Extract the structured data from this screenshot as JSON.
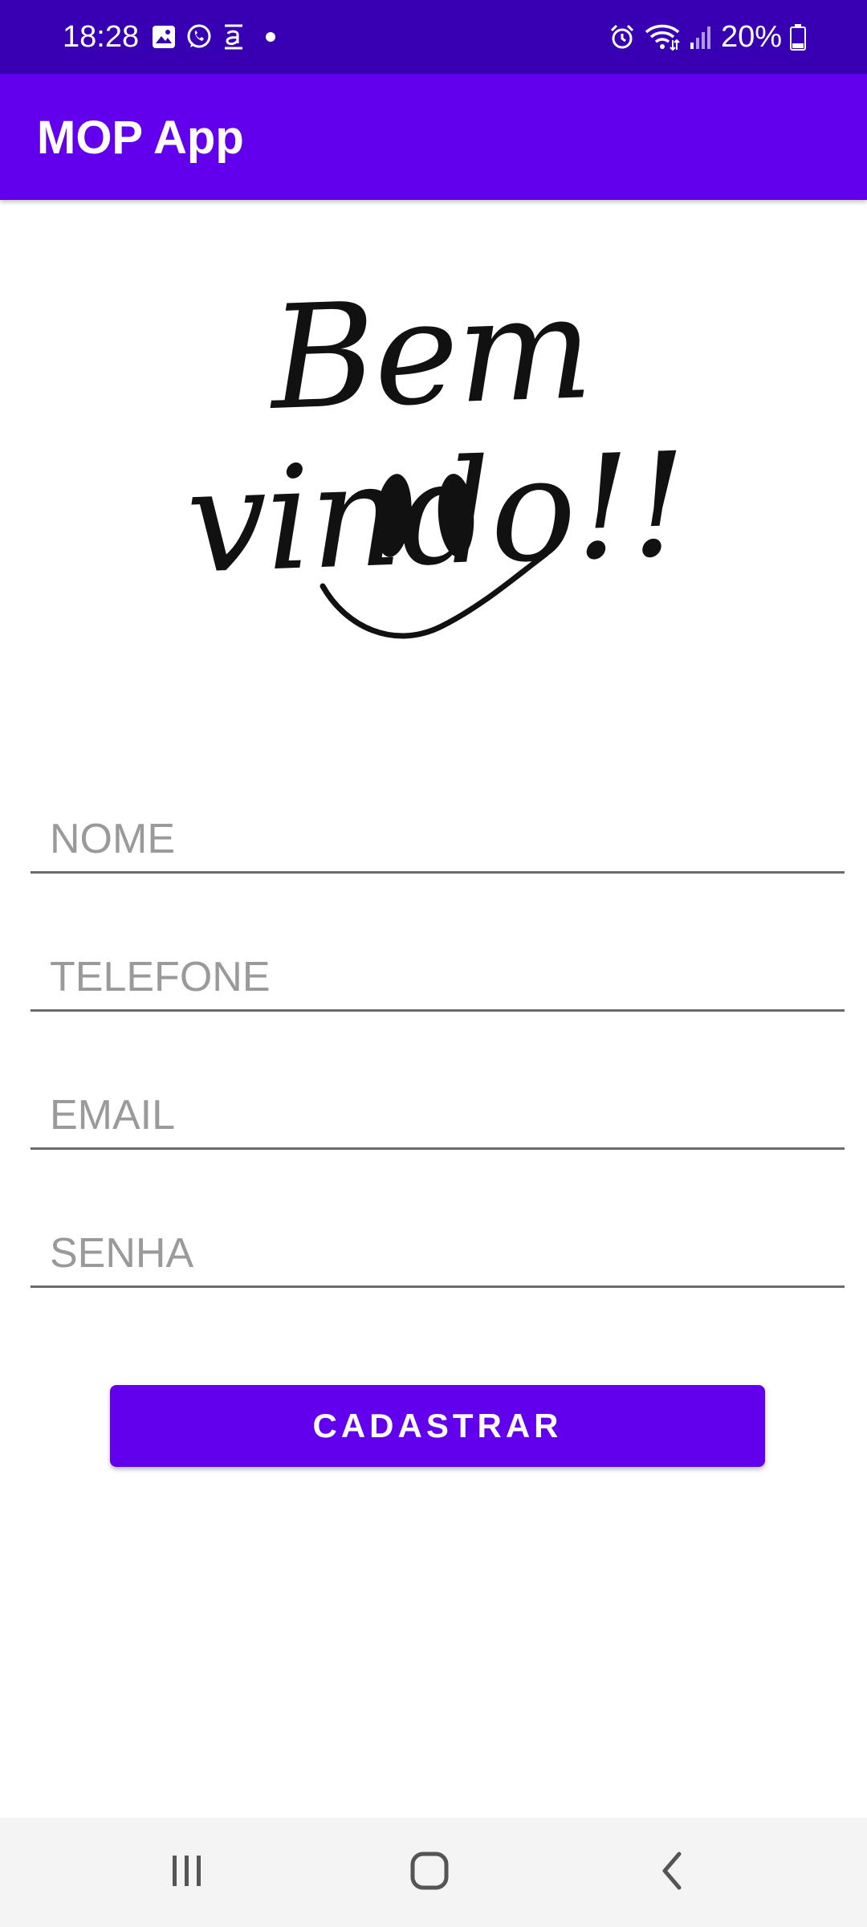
{
  "status_bar": {
    "time": "18:28",
    "battery_percent": "20%",
    "notification_icons": [
      "gallery-icon",
      "whatsapp-icon",
      "amazon-icon",
      "dot-icon"
    ],
    "system_icons": [
      "alarm-icon",
      "wifi-icon",
      "signal-icon",
      "battery-icon"
    ]
  },
  "app_bar": {
    "title": "MOP App"
  },
  "welcome": {
    "text": "Bem vindo!!",
    "icon": "smiley-face-icon"
  },
  "form": {
    "fields": [
      {
        "name": "nome",
        "placeholder": "NOME",
        "value": ""
      },
      {
        "name": "telefone",
        "placeholder": "TELEFONE",
        "value": ""
      },
      {
        "name": "email",
        "placeholder": "EMAIL",
        "value": ""
      },
      {
        "name": "senha",
        "placeholder": "SENHA",
        "value": ""
      }
    ],
    "submit_label": "CADASTRAR"
  },
  "nav_bar": {
    "icons": [
      "recent-apps-icon",
      "home-icon",
      "back-icon"
    ]
  },
  "colors": {
    "status_bar": "#3700B3",
    "primary": "#6200EE",
    "field_underline": "#6b6b6b",
    "placeholder": "#9a9a9a",
    "nav_bar": "#f4f4f4"
  }
}
